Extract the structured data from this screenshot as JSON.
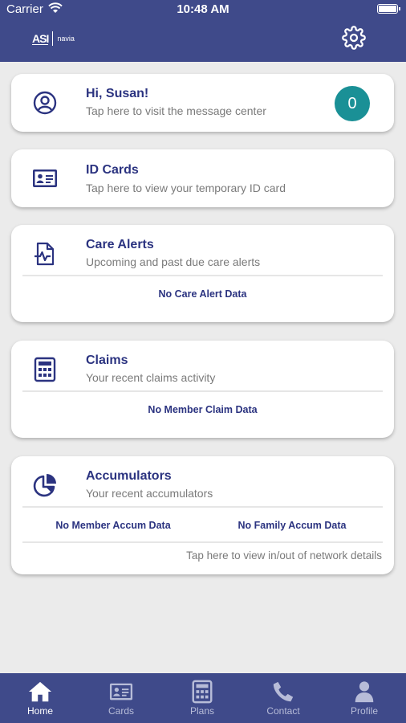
{
  "status_bar": {
    "carrier": "Carrier",
    "time": "10:48 AM"
  },
  "header": {
    "logo_primary": "ASI",
    "logo_secondary": "navia",
    "settings_icon": "gear-icon"
  },
  "cards": {
    "greeting": {
      "title": "Hi, Susan!",
      "subtitle": "Tap here to visit the message center",
      "badge_count": "0",
      "icon": "user-circle-icon"
    },
    "id_cards": {
      "title": "ID Cards",
      "subtitle": "Tap here to view your temporary ID card",
      "icon": "id-card-icon"
    },
    "care_alerts": {
      "title": "Care Alerts",
      "subtitle": "Upcoming and past due care alerts",
      "empty": "No Care Alert Data",
      "icon": "health-document-icon"
    },
    "claims": {
      "title": "Claims",
      "subtitle": "Your recent claims activity",
      "empty": "No Member Claim Data",
      "icon": "calculator-icon"
    },
    "accumulators": {
      "title": "Accumulators",
      "subtitle": "Your recent accumulators",
      "member_empty": "No Member Accum Data",
      "family_empty": "No Family Accum Data",
      "network_link": "Tap here to view in/out of network details",
      "icon": "pie-chart-icon"
    }
  },
  "tabbar": {
    "items": [
      {
        "label": "Home",
        "icon": "home-icon",
        "active": true
      },
      {
        "label": "Cards",
        "icon": "id-card-icon",
        "active": false
      },
      {
        "label": "Plans",
        "icon": "calculator-icon",
        "active": false
      },
      {
        "label": "Contact",
        "icon": "phone-icon",
        "active": false
      },
      {
        "label": "Profile",
        "icon": "person-icon",
        "active": false
      }
    ]
  },
  "colors": {
    "brand": "#3f4a8a",
    "accent": "#1a9096",
    "title": "#2b3380",
    "background": "#ebebeb"
  }
}
